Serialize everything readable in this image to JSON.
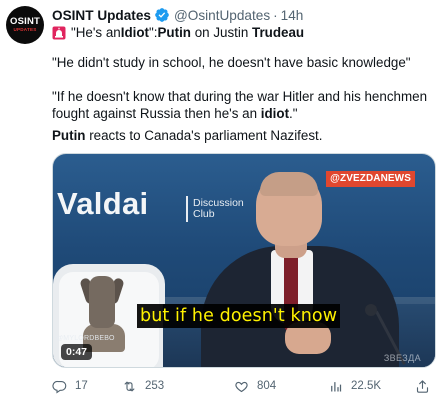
{
  "author": {
    "avatar_line1": "OSINT",
    "avatar_line2": "UPDATES",
    "name": "OSINT Updates",
    "handle": "@OsintUpdates",
    "separator": "·",
    "time": "14h"
  },
  "tweet": {
    "line1": {
      "q_open": "\"He's an ",
      "idiot": "Idiot",
      "q_close": "\": ",
      "putin": "Putin",
      "on": " on Justin ",
      "trudeau": "Trudeau"
    },
    "para2": "\"He didn't study in school, he doesn't have basic knowledge\"",
    "para3": {
      "text": "\"If he doesn't know that during the war Hitler and his henchmen fought against Russia then he's an ",
      "idiot": "idiot",
      "end": ".\""
    },
    "para4": {
      "putin": "Putin",
      "text": " reacts to Canada's parliament Nazifest."
    }
  },
  "media": {
    "valdai": "Valdai",
    "club_line1": "Discussion",
    "club_line2": "Club",
    "channel_tag": "@ZVEZDANEWS",
    "caption": "but if he doesn't know",
    "watermark_left": "@MYLORDBEBO",
    "watermark_right": "ЗВЕЗДА",
    "duration": "0:47"
  },
  "actions": {
    "replies": "17",
    "retweets": "253",
    "likes": "804",
    "views": "22.5K"
  },
  "colors": {
    "text": "#0f1419",
    "muted": "#536471",
    "verified": "#1d9bf0",
    "siren": "#e0245e",
    "caption": "#fff200",
    "channel_tag": "#e0472f"
  },
  "icons": [
    "verified-badge-icon",
    "siren-icon",
    "reply-icon",
    "retweet-icon",
    "like-icon",
    "views-icon",
    "share-icon"
  ]
}
